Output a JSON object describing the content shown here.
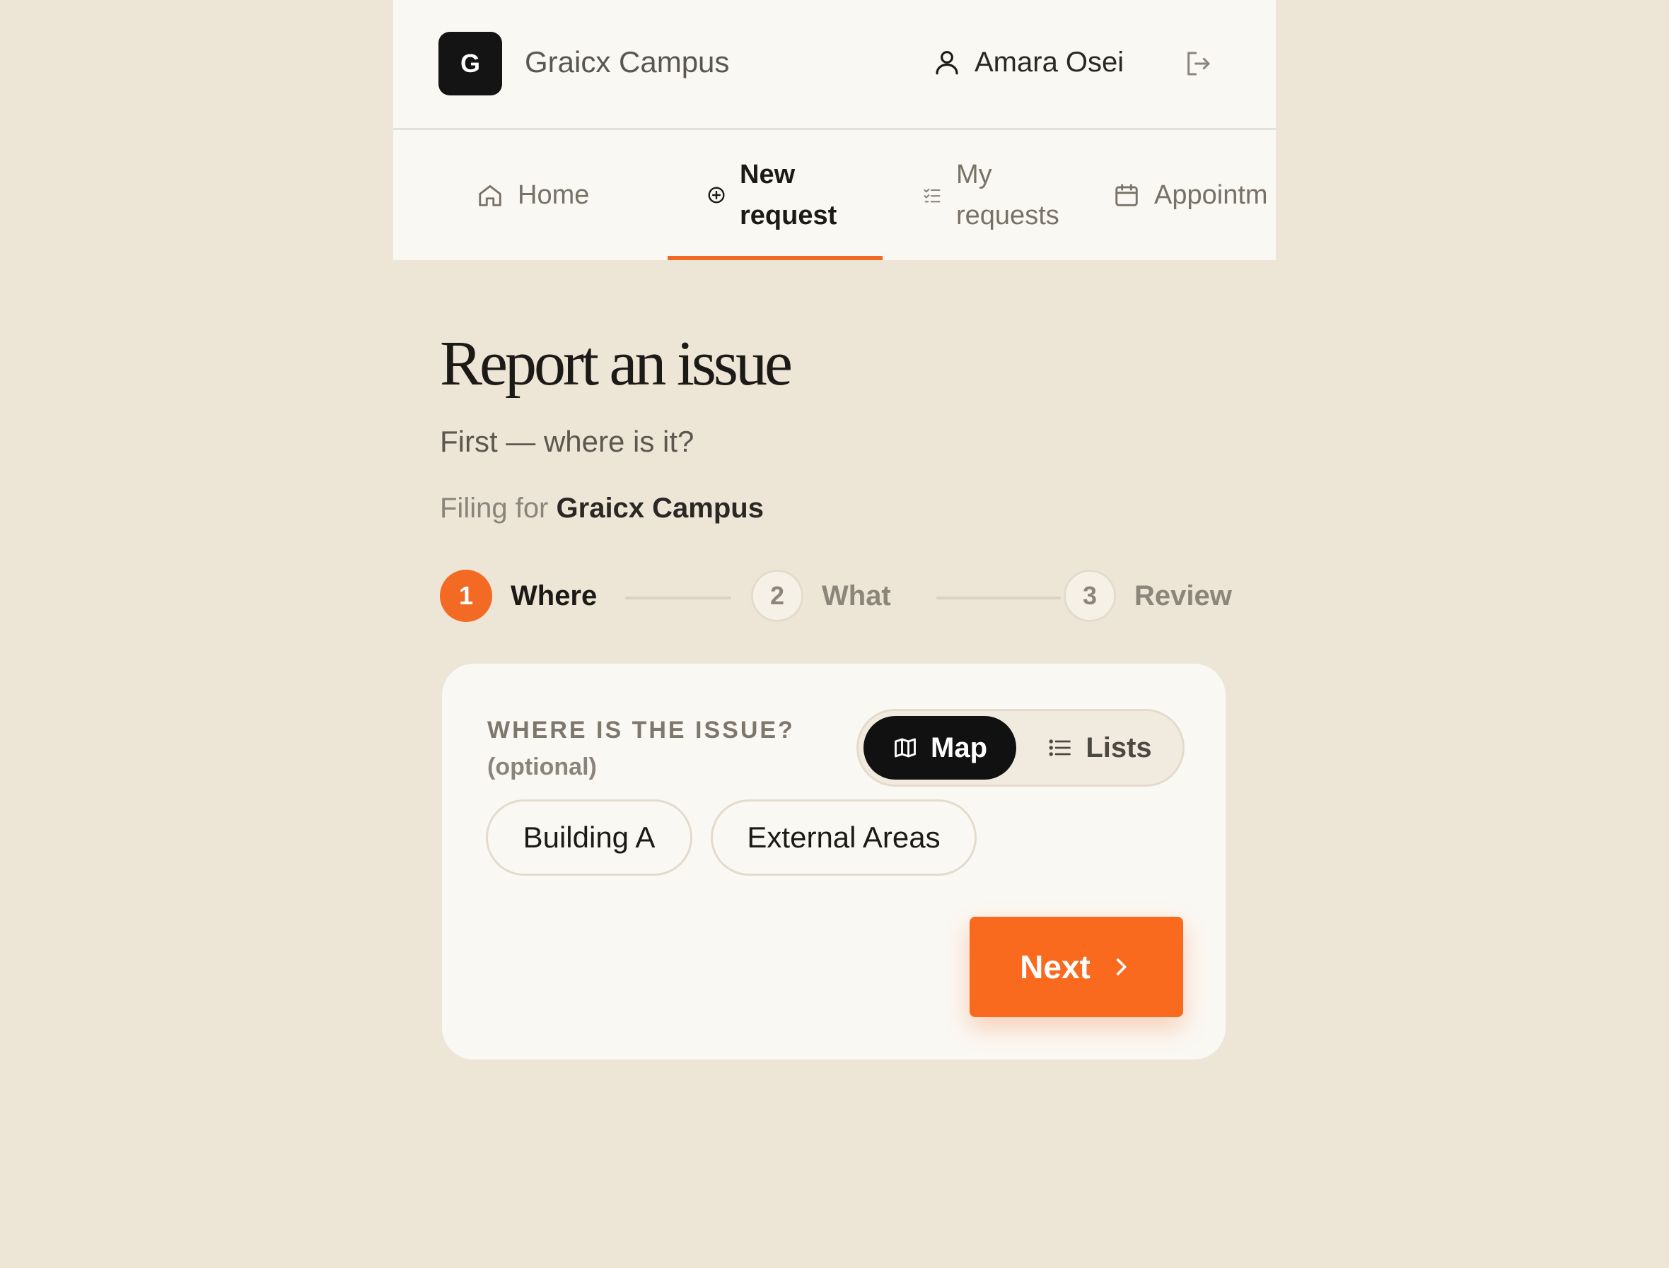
{
  "header": {
    "logo_letter": "G",
    "brand_name": "Graicx Campus",
    "user_name": "Amara Osei"
  },
  "nav": {
    "tabs": [
      {
        "label": "Home",
        "icon": "home-icon",
        "active": false
      },
      {
        "label": "New request",
        "icon": "plus-circle-icon",
        "active": true
      },
      {
        "label": "My requests",
        "icon": "checklist-icon",
        "active": false
      },
      {
        "label": "Appointm",
        "icon": "calendar-icon",
        "active": false
      }
    ]
  },
  "main": {
    "title": "Report an issue",
    "subtitle": "First — where is it?",
    "filing_prefix": "Filing for",
    "filing_org": "Graicx Campus"
  },
  "stepper": {
    "steps": [
      {
        "number": "1",
        "label": "Where",
        "active": true
      },
      {
        "number": "2",
        "label": "What",
        "active": false
      },
      {
        "number": "3",
        "label": "Review",
        "active": false
      }
    ]
  },
  "card": {
    "question_label": "WHERE IS THE ISSUE?",
    "question_hint": "(optional)",
    "view_toggle": {
      "options": [
        {
          "label": "Map",
          "icon": "map-icon",
          "selected": true
        },
        {
          "label": "Lists",
          "icon": "list-icon",
          "selected": false
        }
      ]
    },
    "locations": [
      "Building A",
      "External Areas"
    ],
    "next_label": "Next"
  },
  "colors": {
    "accent": "#f26a24",
    "background": "#ede5d6",
    "surface": "#faf8f3",
    "dark": "#111111"
  }
}
